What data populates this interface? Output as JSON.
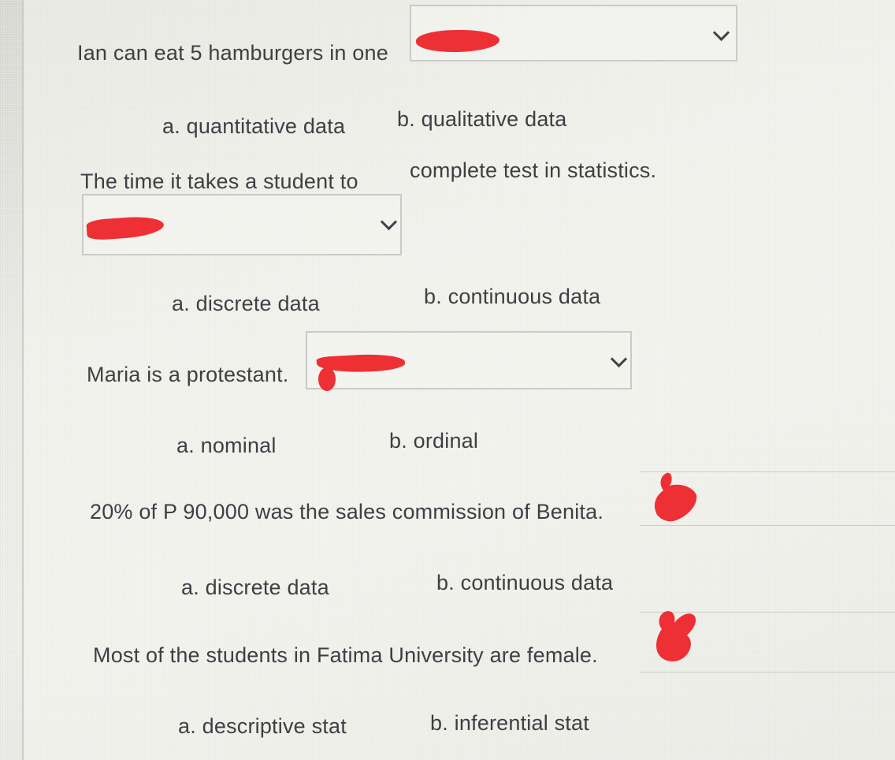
{
  "questions": [
    {
      "prompt": "Ian can eat 5 hamburgers in one",
      "options": [
        "a. quantitative  data",
        "b. qualitative data"
      ]
    },
    {
      "prompt": "The time it takes a student to",
      "prompt_cont": "complete test in statistics.",
      "options": [
        "a. discrete data",
        "b. continuous data"
      ]
    },
    {
      "prompt": "Maria is a protestant.",
      "options": [
        "a. nominal",
        "b. ordinal"
      ]
    },
    {
      "prompt": "20% of P 90,000 was the sales commission of Benita.",
      "options": [
        "a. discrete  data",
        "b. continuous data"
      ]
    },
    {
      "prompt": "Most of the students in Fatima University are female.",
      "options": [
        "a. descriptive   stat",
        "b. inferential stat"
      ]
    }
  ],
  "colors": {
    "text": "#3d3f44",
    "redaction": "#ee2f34",
    "border": "#c9cbc9",
    "background": "#e6e6e2"
  },
  "icons": {
    "dropdown": "chevron-down-icon",
    "annotation": "red-ink-mark"
  }
}
